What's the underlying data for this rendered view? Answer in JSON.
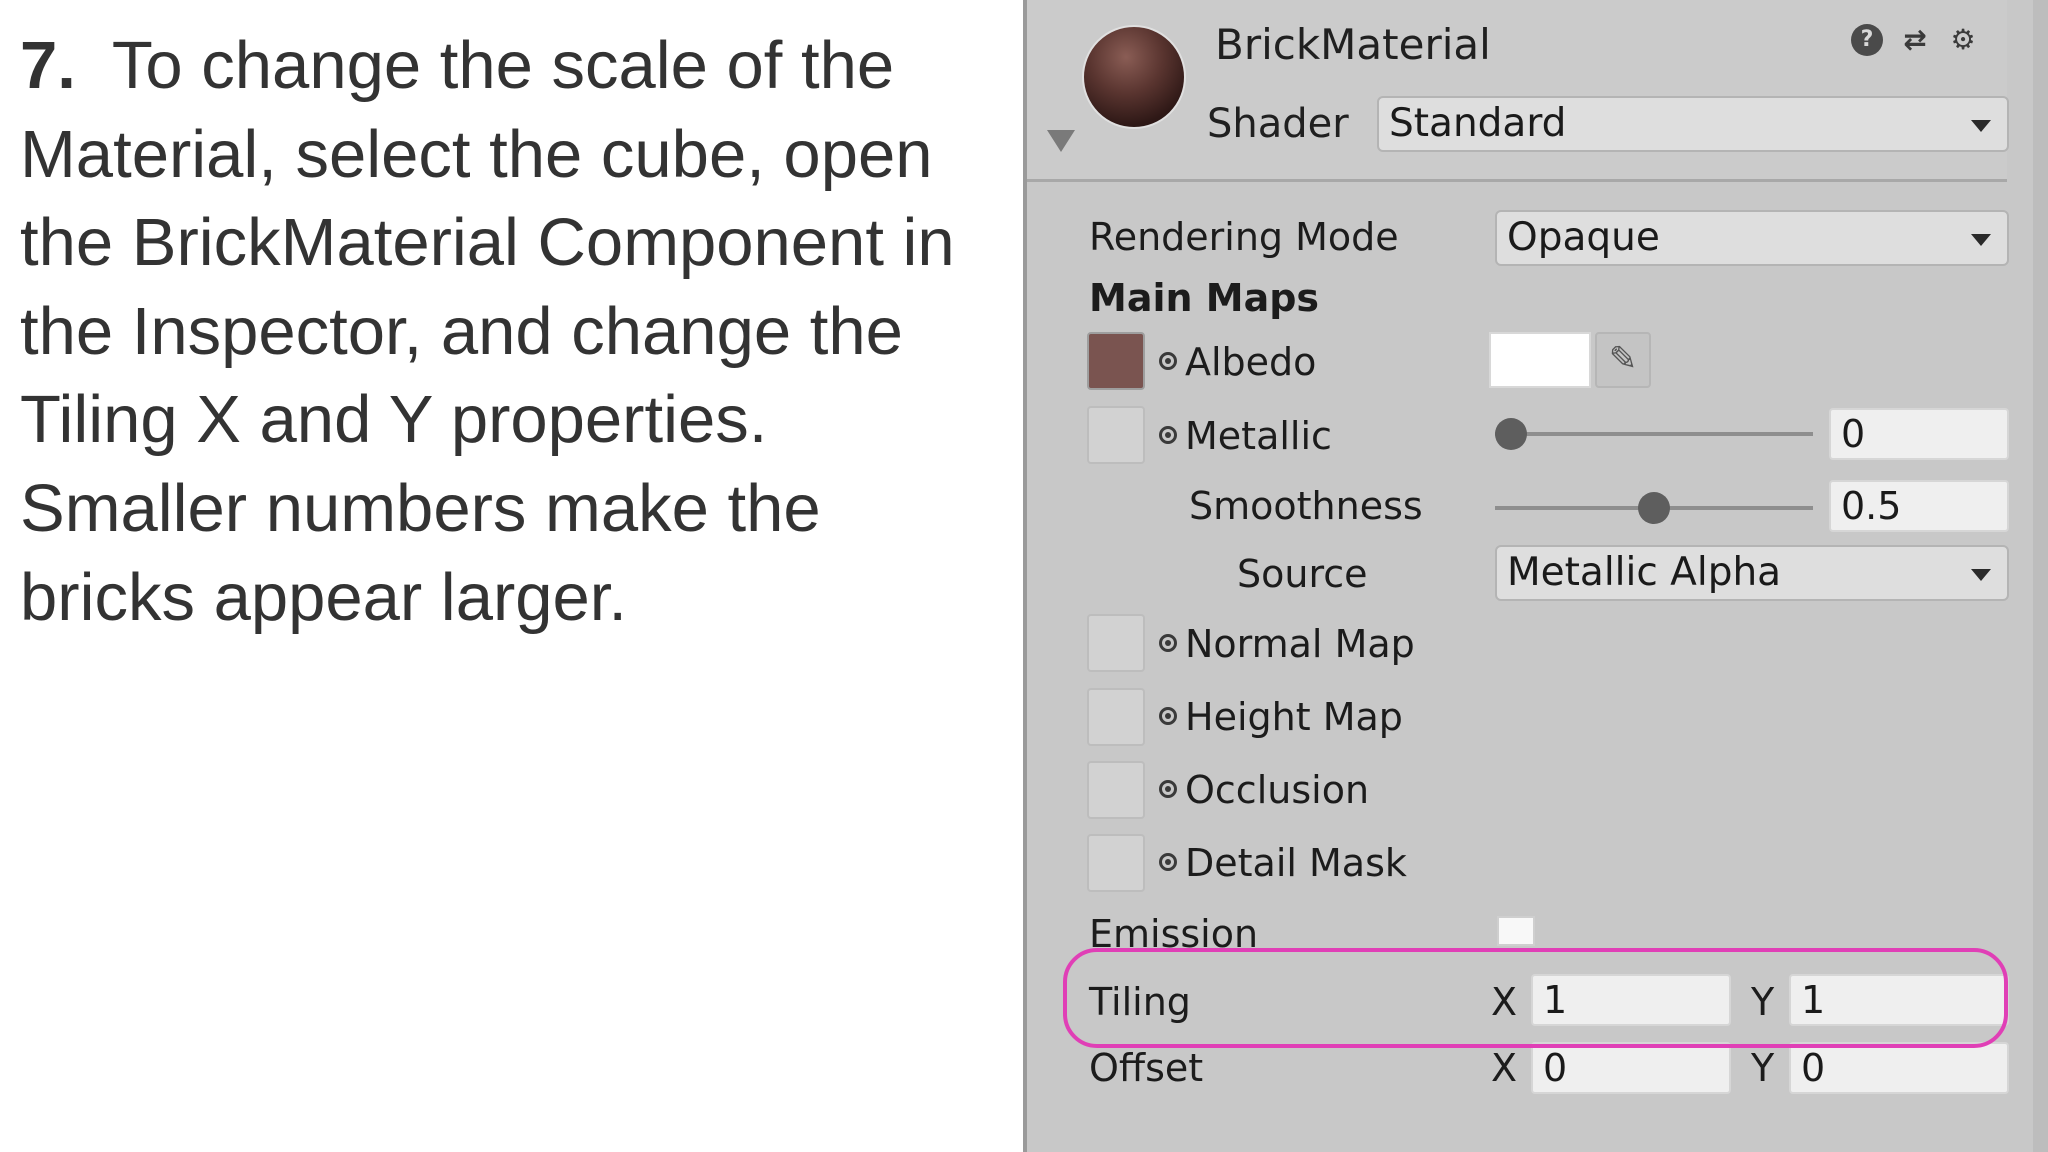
{
  "instruction": {
    "step_number": "7.",
    "text": "To change the scale of the Material, select the cube, open the BrickMaterial Component in the Inspector, and change the Tiling X and Y properties. Smaller numbers make the bricks appear larger."
  },
  "inspector": {
    "material_name": "BrickMaterial",
    "header_icons": [
      "help-icon",
      "presets-icon",
      "settings-icon"
    ],
    "shader": {
      "label": "Shader",
      "value": "Standard"
    },
    "rendering_mode": {
      "label": "Rendering Mode",
      "value": "Opaque"
    },
    "main_maps_heading": "Main Maps",
    "albedo": {
      "label": "Albedo",
      "swatch_color": "#7a5450",
      "color_value": "#ffffff"
    },
    "metallic": {
      "label": "Metallic",
      "value": "0",
      "slider_fraction": 0.0
    },
    "smoothness": {
      "label": "Smoothness",
      "value": "0.5",
      "slider_fraction": 0.5
    },
    "source": {
      "label": "Source",
      "value": "Metallic Alpha"
    },
    "normal_map": {
      "label": "Normal Map"
    },
    "height_map": {
      "label": "Height Map"
    },
    "occlusion": {
      "label": "Occlusion"
    },
    "detail_mask": {
      "label": "Detail Mask"
    },
    "emission": {
      "label": "Emission",
      "checked": false
    },
    "tiling": {
      "label": "Tiling",
      "x_label": "X",
      "x": "1",
      "y_label": "Y",
      "y": "1"
    },
    "offset": {
      "label": "Offset",
      "x_label": "X",
      "x": "0",
      "y_label": "Y",
      "y": "0"
    },
    "highlight_color": "#e03fb6"
  }
}
